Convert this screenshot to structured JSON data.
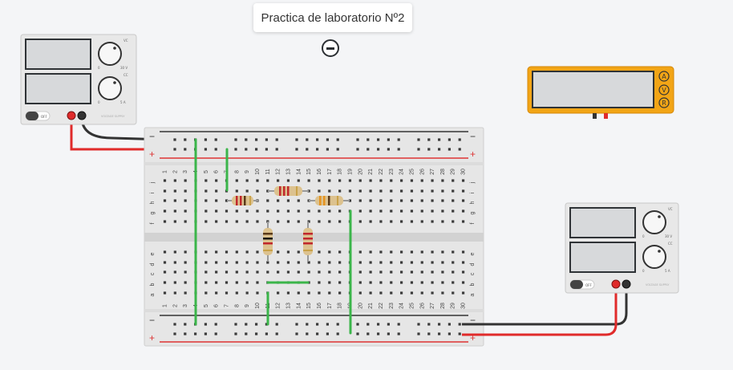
{
  "project": {
    "title": "Practica de laboratorio Nº2"
  },
  "power_supply_1": {
    "knob_top_labels": [
      "VC",
      "0",
      "30 V"
    ],
    "knob_bottom_labels": [
      "CC",
      "0",
      "5 A"
    ],
    "off_label": "OFF",
    "brand": "VOLTAGE SUPPLY"
  },
  "power_supply_2": {
    "knob_top_labels": [
      "VC",
      "0",
      "30 V"
    ],
    "knob_bottom_labels": [
      "CC",
      "0",
      "5 A"
    ],
    "off_label": "OFF",
    "brand": "VOLTAGE SUPPLY"
  },
  "multimeter": {
    "modes": [
      "A",
      "V",
      "R"
    ]
  },
  "breadboard": {
    "columns": [
      "1",
      "2",
      "3",
      "4",
      "5",
      "6",
      "7",
      "8",
      "9",
      "10",
      "11",
      "12",
      "13",
      "14",
      "15",
      "16",
      "17",
      "18",
      "19",
      "20",
      "21",
      "22",
      "23",
      "24",
      "25",
      "26",
      "27",
      "28",
      "29",
      "30"
    ],
    "rows_top": [
      "j",
      "i",
      "h",
      "g",
      "f"
    ],
    "rows_bottom": [
      "e",
      "d",
      "c",
      "b",
      "a"
    ],
    "rail_minus": "−",
    "rail_plus": "+"
  },
  "colors": {
    "wire_red": "#e02b2b",
    "wire_black": "#333333",
    "wire_green": "#3bb54a",
    "multimeter_body": "#f2a516"
  }
}
